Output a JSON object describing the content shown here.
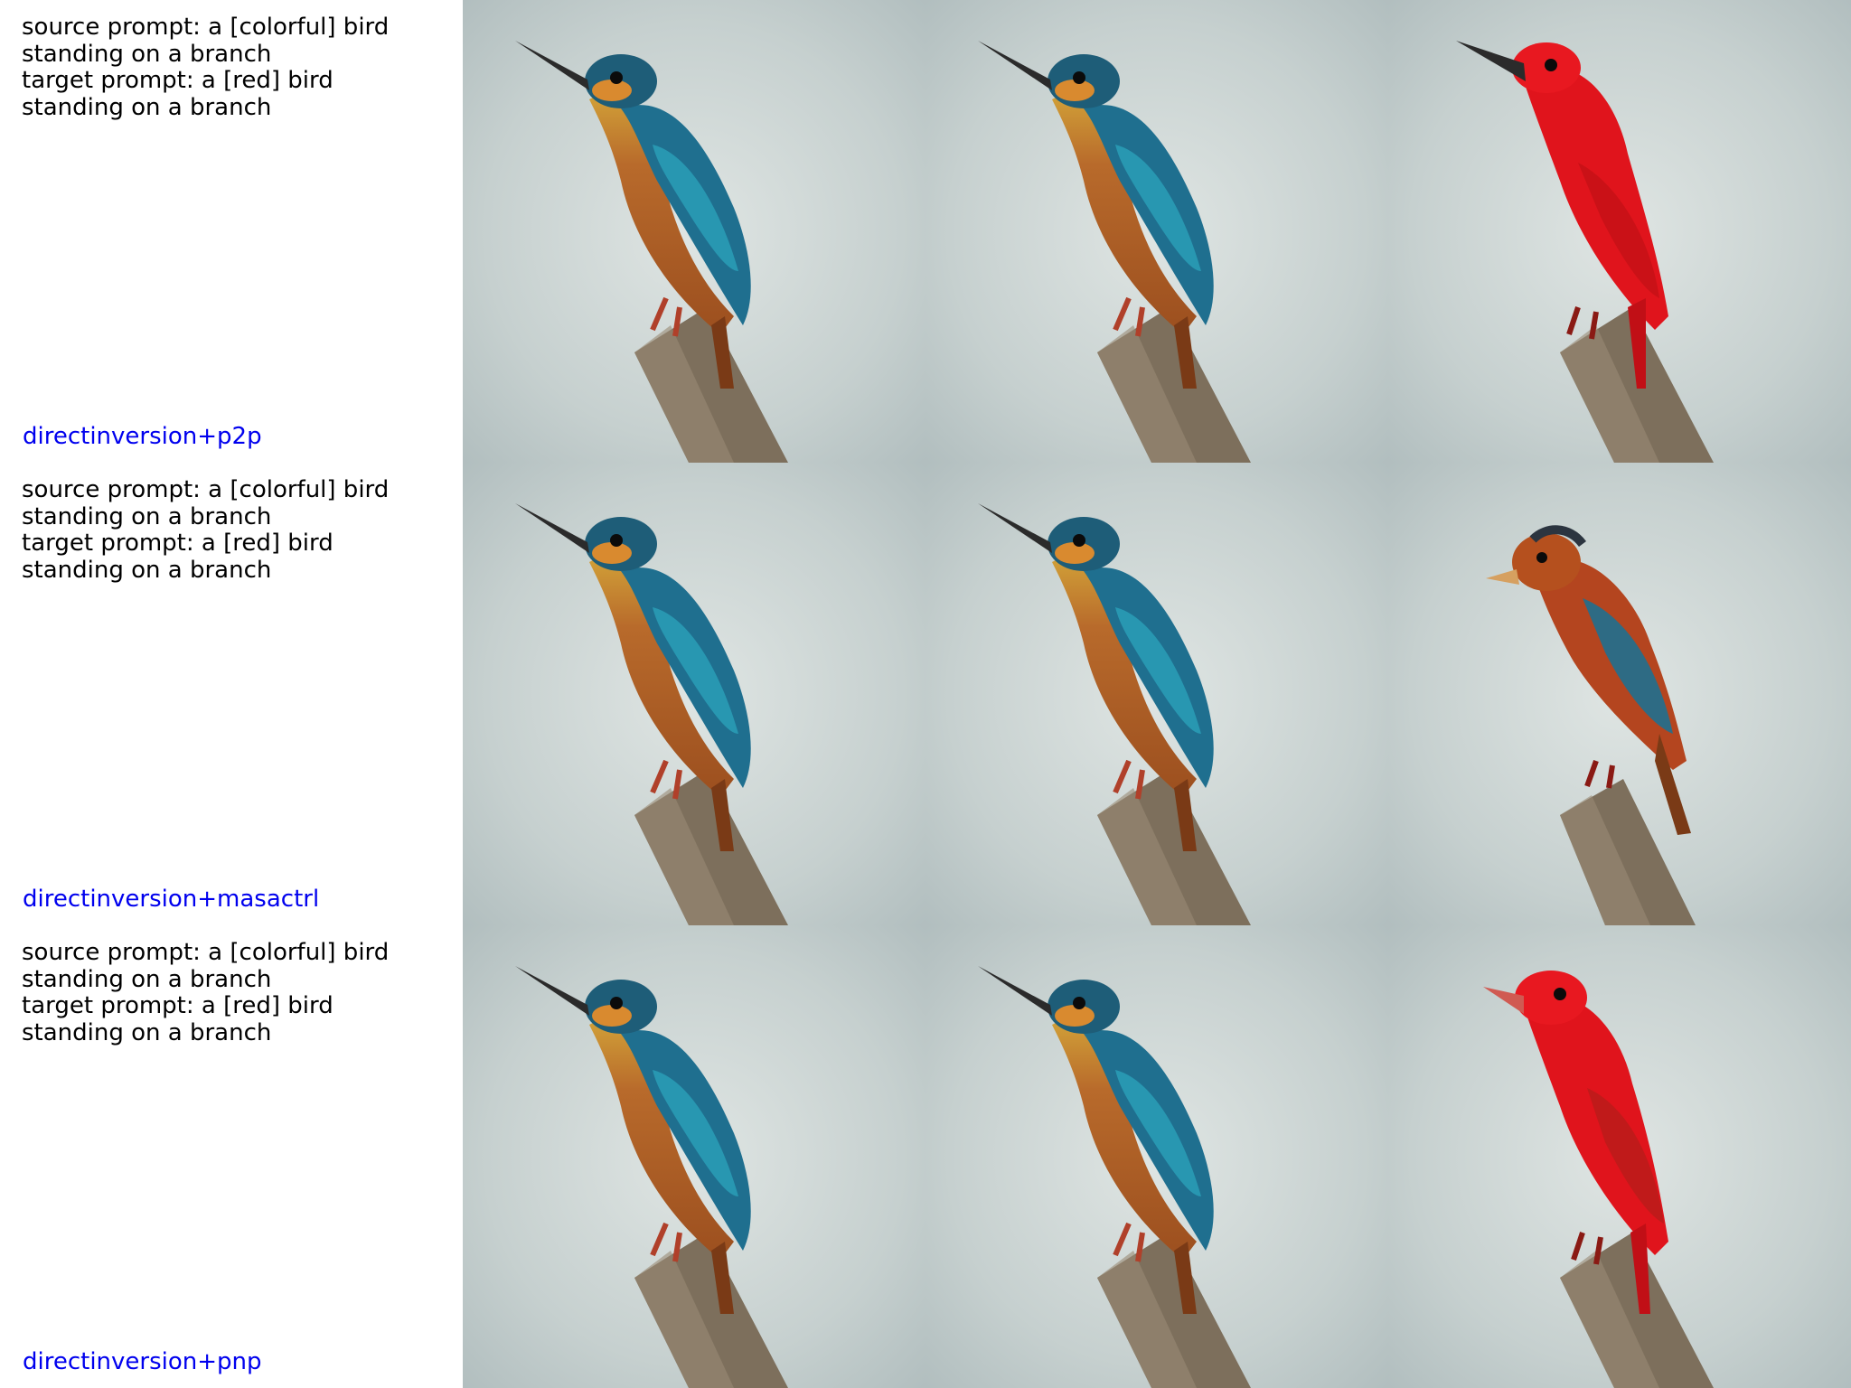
{
  "rows": [
    {
      "source_prompt": "source prompt: a [colorful] bird standing on a branch",
      "target_prompt": "target prompt: a [red] bird standing on a branch",
      "method": "directinversion+p2p",
      "images": [
        "kingfisher-bird-photo",
        "kingfisher-bird-photo",
        "red-bird-photo"
      ]
    },
    {
      "source_prompt": "source prompt: a [colorful] bird standing on a branch",
      "target_prompt": "target prompt: a [red] bird standing on a branch",
      "method": "directinversion+masactrl",
      "images": [
        "kingfisher-bird-photo",
        "kingfisher-bird-photo",
        "brown-red-bird-photo"
      ]
    },
    {
      "source_prompt": "source prompt: a [colorful] bird standing on a branch",
      "target_prompt": "target prompt: a [red] bird standing on a branch",
      "method": "directinversion+pnp",
      "images": [
        "kingfisher-bird-photo",
        "kingfisher-bird-photo",
        "red-bird-photo"
      ]
    }
  ],
  "colors": {
    "method_link": "#0000ee",
    "background_blur": "#c9d2d0",
    "kingfisher_back": "#1f6f8f",
    "kingfisher_breast": "#b5652a",
    "red_bird": "#e0141c",
    "brown_red_bird": "#b4451f",
    "branch": "#7d6f5c"
  }
}
